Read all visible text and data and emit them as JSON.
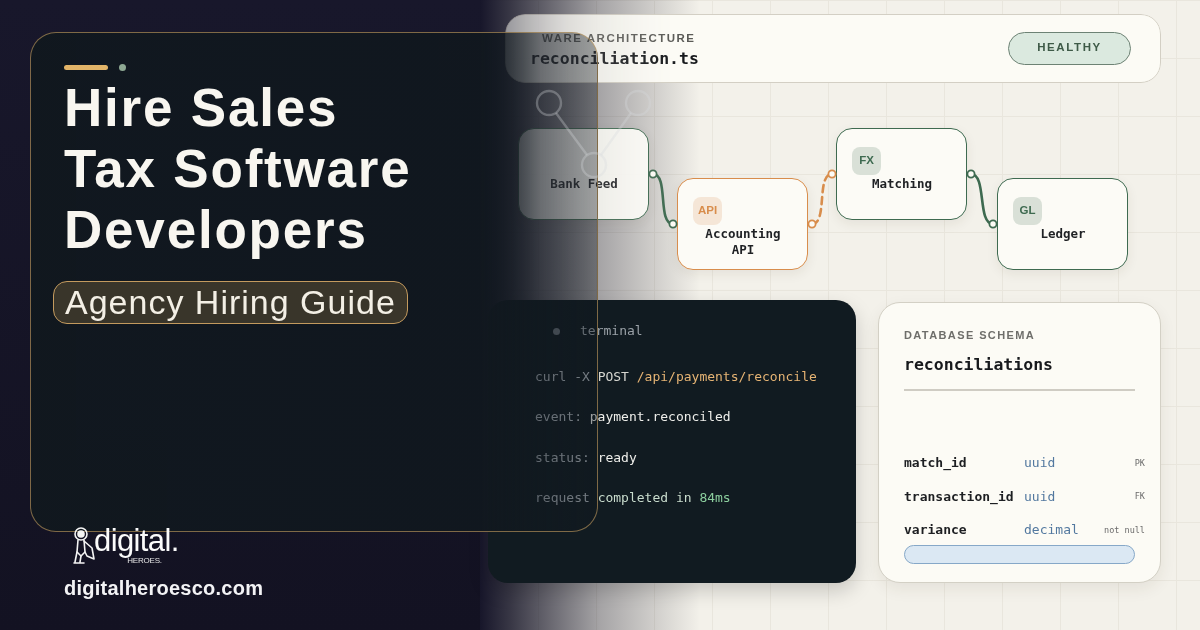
{
  "hero": {
    "title": "Hire Sales\nTax Software\nDevelopers",
    "tag": "Agency Hiring Guide"
  },
  "brand": {
    "logo": "digital.",
    "logo_sub": "HEROES.",
    "website": "digitalheroesco.com"
  },
  "architecture": {
    "label": "WARE ARCHITECTURE",
    "file": "reconciliation.ts",
    "status": "HEALTHY"
  },
  "diagram": {
    "nodes": [
      {
        "label": "Bank Feed",
        "color": "#3e6a50"
      },
      {
        "badge": "API",
        "label": "Accounting API",
        "color": "#d88d4c"
      },
      {
        "badge": "FX",
        "label": "Matching",
        "color": "#3e6a50"
      },
      {
        "badge": "GL",
        "label": "Ledger",
        "color": "#3e6a50"
      }
    ],
    "edges": [
      {
        "kind": "solid",
        "color": "#3e6a50"
      },
      {
        "kind": "dashed",
        "color": "#d88d4c"
      },
      {
        "kind": "solid",
        "color": "#3e6a50"
      }
    ]
  },
  "terminal": {
    "title": "terminal",
    "lines": [
      {
        "segments": [
          {
            "text": "curl -X",
            "kind": "muted"
          },
          {
            "text": "POST",
            "kind": "plain"
          },
          {
            "text": "/api/payments/reconcile",
            "kind": "path"
          }
        ]
      },
      {
        "segments": [
          {
            "text": "event:",
            "kind": "muted"
          },
          {
            "text": "payment.reconciled",
            "kind": "bright"
          }
        ]
      },
      {
        "segments": [
          {
            "text": "status:",
            "kind": "muted"
          },
          {
            "text": "ready",
            "kind": "bright"
          }
        ]
      },
      {
        "segments": [
          {
            "text": "request",
            "kind": "muted"
          },
          {
            "text": "completed in",
            "kind": "success"
          },
          {
            "text": "84ms",
            "kind": "number"
          }
        ]
      }
    ]
  },
  "schema": {
    "label": "DATABASE SCHEMA",
    "table": "reconciliations",
    "fields": [
      {
        "name": "match_id",
        "type": "uuid",
        "constraint": "PK"
      },
      {
        "name": "transaction_id",
        "type": "uuid",
        "constraint": "FK"
      },
      {
        "name": "variance",
        "type": "decimal",
        "constraint": "not null"
      }
    ]
  }
}
